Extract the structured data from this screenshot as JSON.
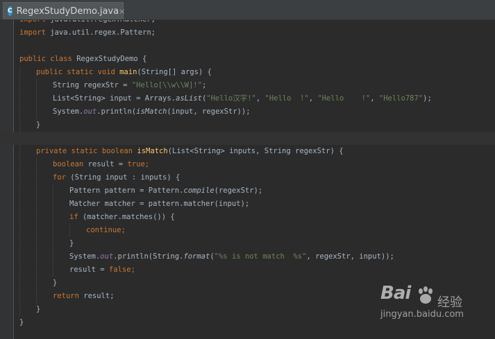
{
  "tab": {
    "icon_letter": "C",
    "title": "RegexStudyDemo.java",
    "close": "×"
  },
  "code": {
    "lines": [
      {
        "indent": 0,
        "tokens": [
          [
            "kw",
            "import "
          ],
          [
            "plain",
            "java.util.regex.Matcher;"
          ]
        ]
      },
      {
        "indent": 0,
        "tokens": [
          [
            "kw",
            "import "
          ],
          [
            "plain",
            "java.util.regex.Pattern;"
          ]
        ]
      },
      {
        "indent": 0,
        "tokens": []
      },
      {
        "indent": 0,
        "tokens": [
          [
            "kw",
            "public class "
          ],
          [
            "plain",
            "RegexStudyDemo {"
          ]
        ]
      },
      {
        "indent": 1,
        "tokens": [
          [
            "kw",
            "public static void "
          ],
          [
            "fn",
            "main"
          ],
          [
            "plain",
            "(String[] args) {"
          ]
        ]
      },
      {
        "indent": 2,
        "tokens": [
          [
            "plain",
            "String regexStr = "
          ],
          [
            "str",
            "\"Hello[\\\\w\\\\W]!\""
          ],
          [
            "plain",
            ";"
          ]
        ]
      },
      {
        "indent": 2,
        "tokens": [
          [
            "plain",
            "List<String> input = Arrays."
          ],
          [
            "it",
            "asList"
          ],
          [
            "plain",
            "("
          ],
          [
            "str",
            "\"Hello汉字!\""
          ],
          [
            "plain",
            ", "
          ],
          [
            "str",
            "\"Hello  !\""
          ],
          [
            "plain",
            ", "
          ],
          [
            "str",
            "\"Hello    !\""
          ],
          [
            "plain",
            ", "
          ],
          [
            "str",
            "\"Hello787\""
          ],
          [
            "plain",
            ");"
          ]
        ]
      },
      {
        "indent": 2,
        "tokens": [
          [
            "plain",
            "System."
          ],
          [
            "st",
            "out"
          ],
          [
            "plain",
            ".println("
          ],
          [
            "it",
            "isMatch"
          ],
          [
            "plain",
            "(input, regexStr));"
          ]
        ]
      },
      {
        "indent": 1,
        "tokens": [
          [
            "plain",
            "}"
          ]
        ]
      },
      {
        "indent": 0,
        "caret": true,
        "tokens": []
      },
      {
        "indent": 1,
        "tokens": [
          [
            "kw",
            "private static boolean "
          ],
          [
            "fn",
            "isMatch"
          ],
          [
            "plain",
            "(List<String> inputs, String regexStr) {"
          ]
        ]
      },
      {
        "indent": 2,
        "tokens": [
          [
            "kw",
            "boolean "
          ],
          [
            "plain",
            "result = "
          ],
          [
            "kw",
            "true"
          ],
          [
            "kw",
            ";"
          ]
        ]
      },
      {
        "indent": 2,
        "tokens": [
          [
            "kw",
            "for "
          ],
          [
            "plain",
            "(String input : inputs) {"
          ]
        ]
      },
      {
        "indent": 3,
        "tokens": [
          [
            "plain",
            "Pattern pattern = Pattern."
          ],
          [
            "it",
            "compile"
          ],
          [
            "plain",
            "(regexStr);"
          ]
        ]
      },
      {
        "indent": 3,
        "tokens": [
          [
            "plain",
            "Matcher matcher = pattern.matcher(input);"
          ]
        ]
      },
      {
        "indent": 3,
        "tokens": [
          [
            "kw",
            "if "
          ],
          [
            "plain",
            "(matcher.matches()) {"
          ]
        ]
      },
      {
        "indent": 4,
        "tokens": [
          [
            "kw",
            "continue;"
          ]
        ]
      },
      {
        "indent": 3,
        "tokens": [
          [
            "plain",
            "}"
          ]
        ]
      },
      {
        "indent": 3,
        "tokens": [
          [
            "plain",
            "System."
          ],
          [
            "st",
            "out"
          ],
          [
            "plain",
            ".println(String."
          ],
          [
            "it",
            "format"
          ],
          [
            "plain",
            "("
          ],
          [
            "str",
            "\"%s is not match  %s\""
          ],
          [
            "plain",
            ", regexStr, input));"
          ]
        ]
      },
      {
        "indent": 3,
        "tokens": [
          [
            "plain",
            "result = "
          ],
          [
            "kw",
            "false;"
          ]
        ]
      },
      {
        "indent": 2,
        "tokens": [
          [
            "plain",
            "}"
          ]
        ]
      },
      {
        "indent": 2,
        "tokens": [
          [
            "kw",
            "return "
          ],
          [
            "plain",
            "result;"
          ]
        ]
      },
      {
        "indent": 1,
        "tokens": [
          [
            "plain",
            "}"
          ]
        ]
      },
      {
        "indent": 0,
        "tokens": [
          [
            "plain",
            "}"
          ]
        ]
      }
    ]
  },
  "watermark": {
    "brand": "Bai",
    "brand_cn": "经验",
    "url": "jingyan.baidu.com"
  }
}
